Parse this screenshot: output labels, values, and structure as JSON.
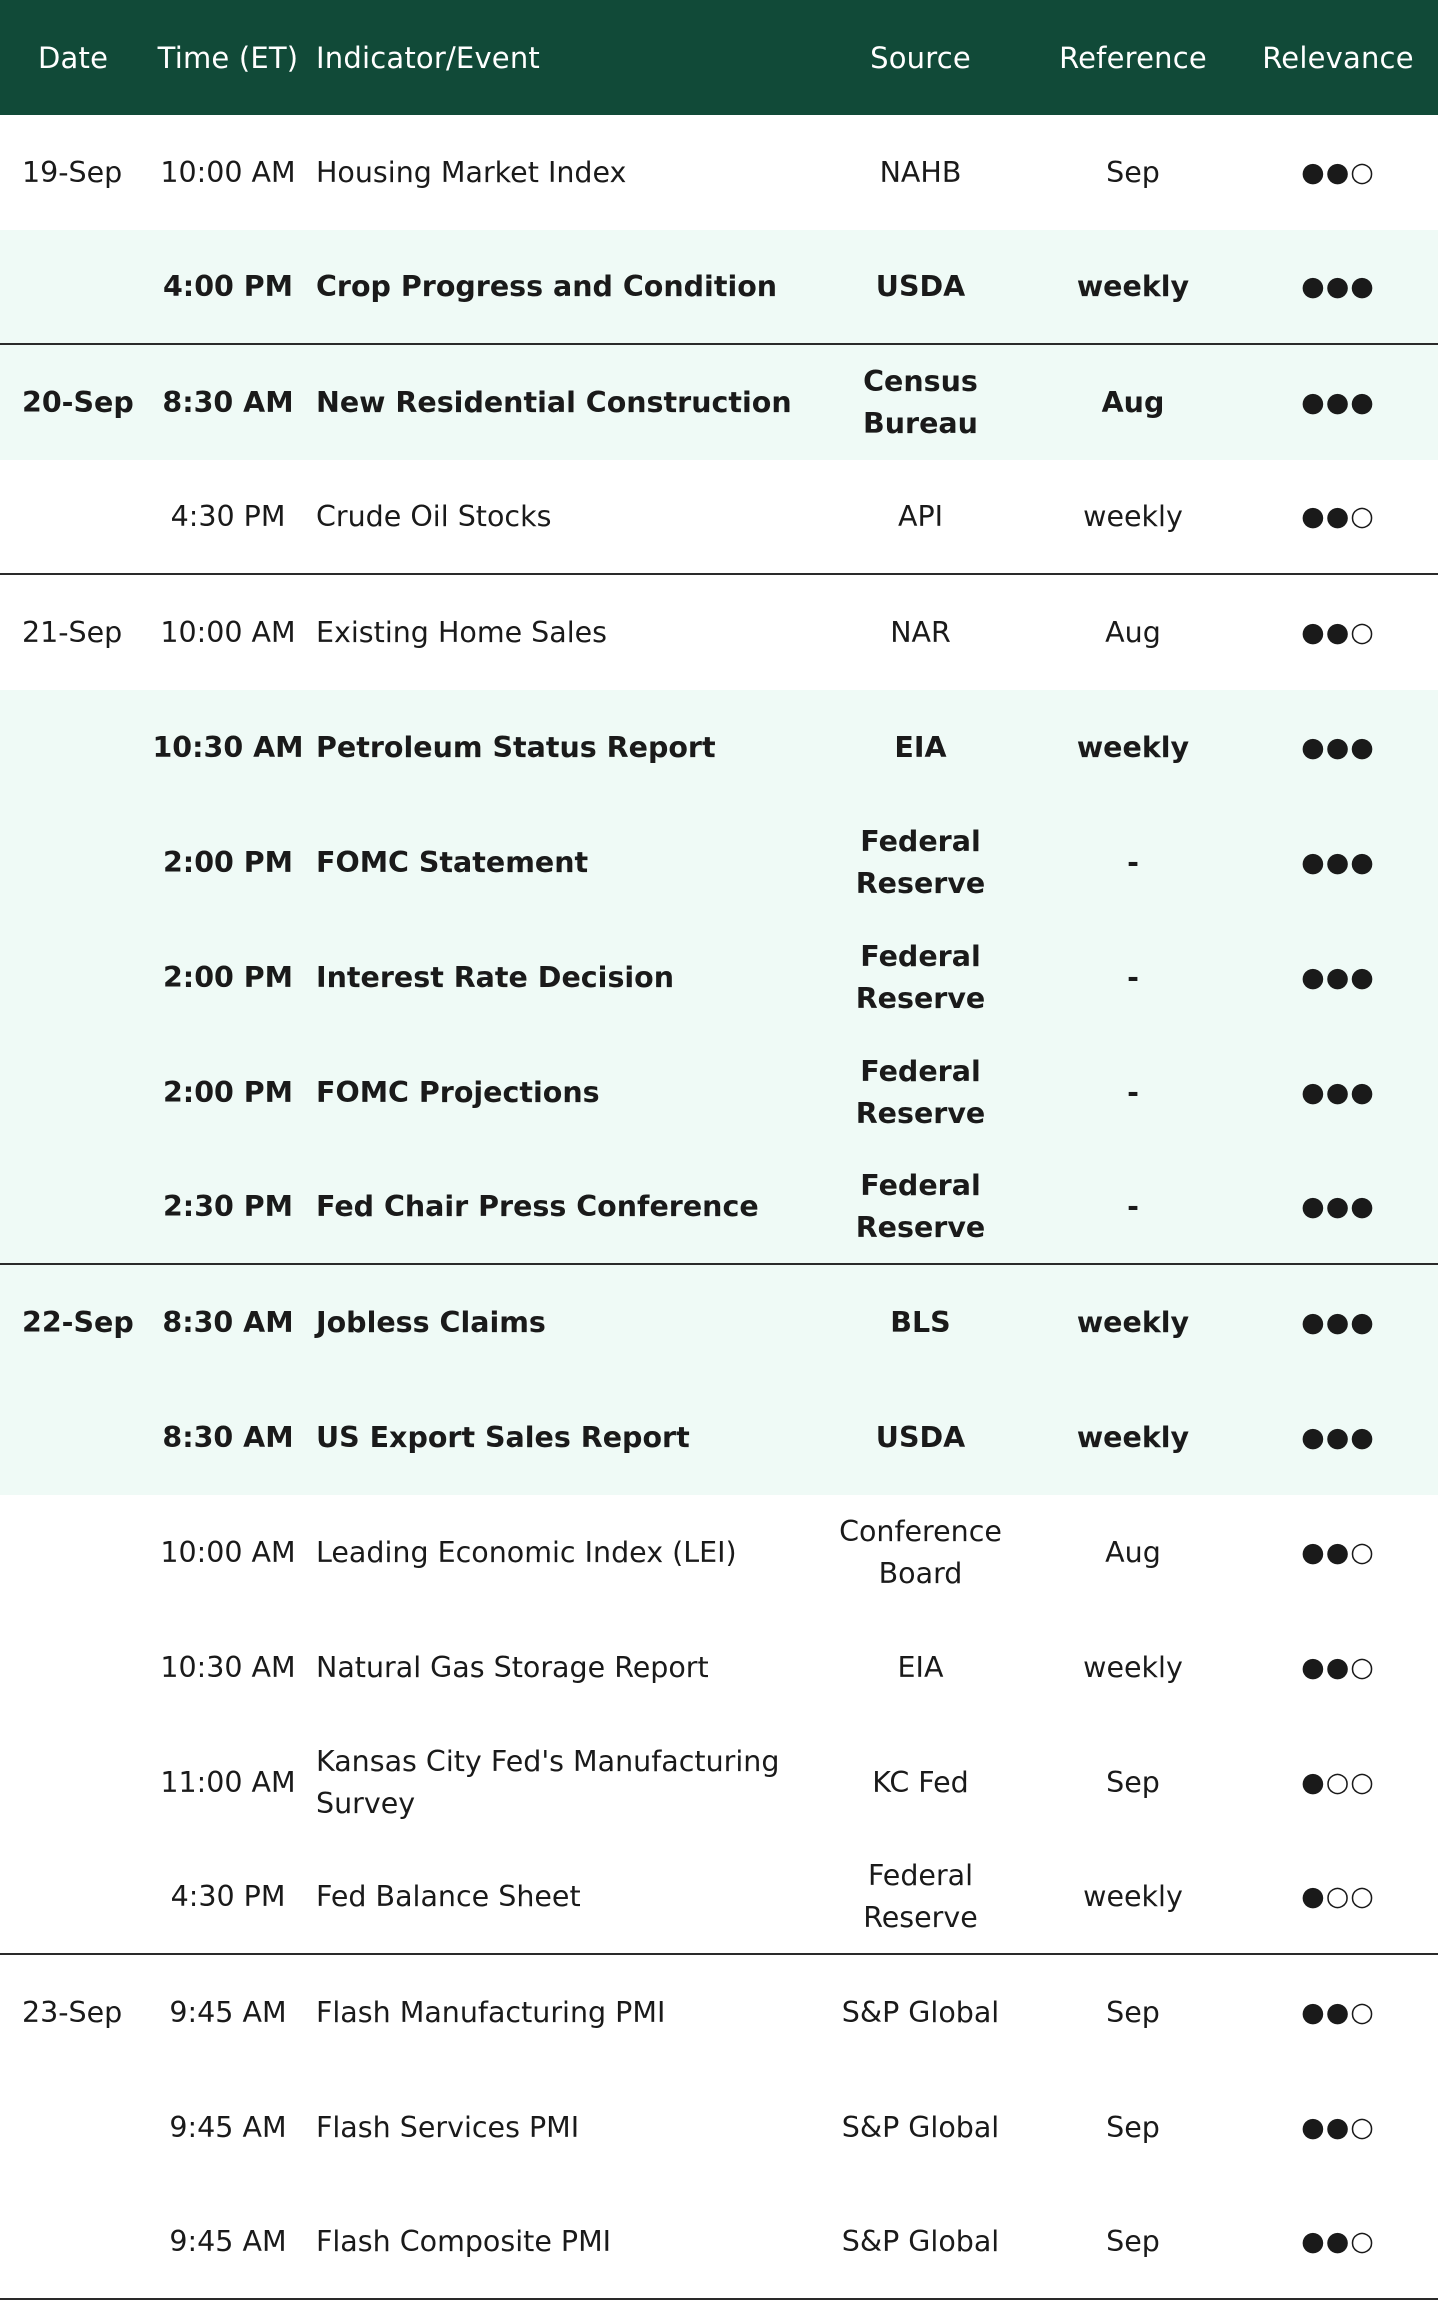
{
  "table": {
    "headers": [
      "Date",
      "Time (ET)",
      "Indicator/Event",
      "Source",
      "Reference",
      "Relevance"
    ],
    "rows": [
      {
        "date": "19-Sep",
        "time": "10:00 AM",
        "event": "Housing Market Index",
        "source": "NAHB",
        "reference": "Sep",
        "relevance": "●●○",
        "highlight": false,
        "separator": false
      },
      {
        "date": "",
        "time": "4:00 PM",
        "event": "Crop Progress and Condition",
        "source": "USDA",
        "reference": "weekly",
        "relevance": "●●●",
        "highlight": true,
        "separator": true
      },
      {
        "date": "20-Sep",
        "time": "8:30 AM",
        "event": "New Residential Construction",
        "source": "Census Bureau",
        "reference": "Aug",
        "relevance": "●●●",
        "highlight": true,
        "separator": false
      },
      {
        "date": "",
        "time": "4:30 PM",
        "event": "Crude Oil Stocks",
        "source": "API",
        "reference": "weekly",
        "relevance": "●●○",
        "highlight": false,
        "separator": true
      },
      {
        "date": "21-Sep",
        "time": "10:00 AM",
        "event": "Existing Home Sales",
        "source": "NAR",
        "reference": "Aug",
        "relevance": "●●○",
        "highlight": false,
        "separator": false
      },
      {
        "date": "",
        "time": "10:30 AM",
        "event": "Petroleum Status Report",
        "source": "EIA",
        "reference": "weekly",
        "relevance": "●●●",
        "highlight": true,
        "separator": false
      },
      {
        "date": "",
        "time": "2:00 PM",
        "event": "FOMC Statement",
        "source": "Federal Reserve",
        "reference": "-",
        "relevance": "●●●",
        "highlight": true,
        "separator": false
      },
      {
        "date": "",
        "time": "2:00 PM",
        "event": "Interest Rate Decision",
        "source": "Federal Reserve",
        "reference": "-",
        "relevance": "●●●",
        "highlight": true,
        "separator": false
      },
      {
        "date": "",
        "time": "2:00 PM",
        "event": "FOMC Projections",
        "source": "Federal Reserve",
        "reference": "-",
        "relevance": "●●●",
        "highlight": true,
        "separator": false
      },
      {
        "date": "",
        "time": "2:30 PM",
        "event": "Fed Chair Press Conference",
        "source": "Federal Reserve",
        "reference": "-",
        "relevance": "●●●",
        "highlight": true,
        "separator": true
      },
      {
        "date": "22-Sep",
        "time": "8:30 AM",
        "event": "Jobless Claims",
        "source": "BLS",
        "reference": "weekly",
        "relevance": "●●●",
        "highlight": true,
        "separator": false
      },
      {
        "date": "",
        "time": "8:30 AM",
        "event": "US Export Sales Report",
        "source": "USDA",
        "reference": "weekly",
        "relevance": "●●●",
        "highlight": true,
        "separator": false
      },
      {
        "date": "",
        "time": "10:00 AM",
        "event": "Leading Economic Index (LEI)",
        "source": "Conference Board",
        "reference": "Aug",
        "relevance": "●●○",
        "highlight": false,
        "separator": false
      },
      {
        "date": "",
        "time": "10:30 AM",
        "event": "Natural Gas Storage Report",
        "source": "EIA",
        "reference": "weekly",
        "relevance": "●●○",
        "highlight": false,
        "separator": false
      },
      {
        "date": "",
        "time": "11:00 AM",
        "event": "Kansas City Fed's Manufacturing Survey",
        "source": "KC Fed",
        "reference": "Sep",
        "relevance": "●○○",
        "highlight": false,
        "separator": false
      },
      {
        "date": "",
        "time": "4:30 PM",
        "event": "Fed Balance Sheet",
        "source": "Federal Reserve",
        "reference": "weekly",
        "relevance": "●○○",
        "highlight": false,
        "separator": true
      },
      {
        "date": "23-Sep",
        "time": "9:45 AM",
        "event": "Flash Manufacturing PMI",
        "source": "S&P Global",
        "reference": "Sep",
        "relevance": "●●○",
        "highlight": false,
        "separator": false
      },
      {
        "date": "",
        "time": "9:45 AM",
        "event": "Flash Services PMI",
        "source": "S&P Global",
        "reference": "Sep",
        "relevance": "●●○",
        "highlight": false,
        "separator": false
      },
      {
        "date": "",
        "time": "9:45 AM",
        "event": "Flash Composite PMI",
        "source": "S&P Global",
        "reference": "Sep",
        "relevance": "●●○",
        "highlight": false,
        "separator": true
      }
    ]
  },
  "colors": {
    "header_bg": "#114a38",
    "header_text": "#ffffff",
    "highlight_bg": "#effaf6",
    "separator": "#2a2a2a",
    "text": "#1a1a1a"
  }
}
